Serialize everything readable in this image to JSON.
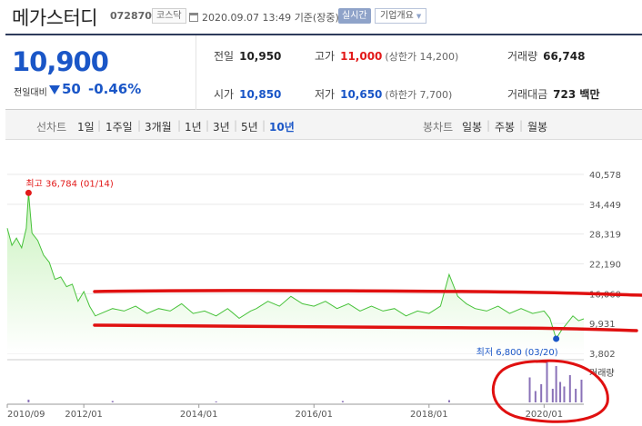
{
  "header": {
    "name": "메가스터디",
    "code": "072870",
    "market": "코스닥",
    "datetime": "2020.09.07 13:49",
    "basis": "기준(장중)",
    "live_label": "실시간",
    "corp_label": "기업개요"
  },
  "quote": {
    "price": "10,900",
    "change_label": "전일대비",
    "change": "50",
    "change_pct": "-0.46%",
    "prev_label": "전일",
    "prev": "10,950",
    "high_label": "고가",
    "high": "11,000",
    "upper_limit": "(상한가 14,200)",
    "volume_label": "거래량",
    "volume": "66,748",
    "open_label": "시가",
    "open": "10,850",
    "low_label": "저가",
    "low": "10,650",
    "lower_limit": "(하한가 7,700)",
    "amount_label": "거래대금",
    "amount": "723 백만"
  },
  "periods": {
    "line_label": "선차트",
    "line_items": [
      "1일",
      "1주일",
      "3개월",
      "1년",
      "3년",
      "5년",
      "10년"
    ],
    "selected": "10년",
    "candle_label": "봉차트",
    "candle_items": [
      "일봉",
      "주봉",
      "월봉"
    ]
  },
  "colors": {
    "accent": "#1a56c7",
    "up": "#e21a1a",
    "line": "#47c23a",
    "fill_top": "#c9f2bd",
    "volume": "#8a72b8",
    "annot": "#e01010"
  },
  "chart_data": {
    "type": "area",
    "y_ticks": [
      40578,
      34449,
      28319,
      22190,
      16060,
      9931,
      3802
    ],
    "ylim": [
      3802,
      40578
    ],
    "x_ticks": [
      "2010/09",
      "2012/01",
      "2014/01",
      "2016/01",
      "2018/01",
      "2020/01"
    ],
    "max_label": "최고 36,784 (01/14)",
    "max_point": {
      "x": 2011.04,
      "y": 36784
    },
    "min_label": "최저 6,800 (03/20)",
    "min_point": {
      "x": 2020.21,
      "y": 6800
    },
    "volume_label": "거래량",
    "series": [
      {
        "x": [
          2010.67,
          2010.75,
          2010.83,
          2010.92,
          2011.0,
          2011.04,
          2011.1,
          2011.2,
          2011.3,
          2011.4,
          2011.5,
          2011.6,
          2011.7,
          2011.8,
          2011.9,
          2012.0,
          2012.1,
          2012.2,
          2012.3,
          2012.5,
          2012.7,
          2012.9,
          2013.1,
          2013.3,
          2013.5,
          2013.7,
          2013.9,
          2014.1,
          2014.3,
          2014.5,
          2014.7,
          2014.9,
          2015.0,
          2015.2,
          2015.4,
          2015.6,
          2015.8,
          2016.0,
          2016.2,
          2016.4,
          2016.6,
          2016.8,
          2017.0,
          2017.2,
          2017.4,
          2017.6,
          2017.8,
          2018.0,
          2018.2,
          2018.35,
          2018.5,
          2018.65,
          2018.8,
          2019.0,
          2019.2,
          2019.4,
          2019.6,
          2019.8,
          2020.0,
          2020.1,
          2020.21,
          2020.3,
          2020.4,
          2020.5,
          2020.6,
          2020.69
        ],
        "y": [
          29500,
          26000,
          27500,
          25500,
          29500,
          36784,
          28500,
          27000,
          24000,
          22500,
          19000,
          19500,
          17500,
          18000,
          14500,
          16500,
          13500,
          11500,
          12000,
          13000,
          12500,
          13500,
          12000,
          13000,
          12500,
          14000,
          12000,
          12500,
          11500,
          13000,
          11000,
          12500,
          13000,
          14500,
          13500,
          15500,
          14000,
          13500,
          14500,
          13000,
          14000,
          12500,
          13500,
          12500,
          13000,
          11500,
          12500,
          12000,
          13500,
          20000,
          15500,
          14000,
          13000,
          12500,
          13500,
          12000,
          13000,
          12000,
          12500,
          11000,
          6800,
          8500,
          10000,
          11500,
          10500,
          10900
        ]
      }
    ],
    "volume": {
      "x": [
        2011.04,
        2012.5,
        2014.3,
        2016.5,
        2018.35,
        2019.75,
        2019.85,
        2019.95,
        2020.05,
        2020.15,
        2020.21,
        2020.28,
        2020.35,
        2020.45,
        2020.55,
        2020.65
      ],
      "values": [
        6,
        3,
        2,
        3,
        5,
        55,
        25,
        40,
        90,
        30,
        80,
        45,
        35,
        60,
        30,
        50
      ]
    }
  }
}
